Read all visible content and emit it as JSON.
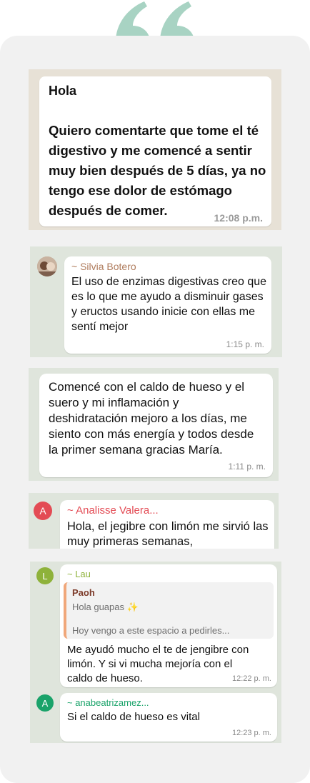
{
  "colors": {
    "quote": "#a8d3c3",
    "card_bg": "#f1f1f1",
    "sender_silvia": "#b07d5e",
    "sender_analisse": "#e34b54",
    "sender_lau": "#8eb23a",
    "sender_anabea": "#1aa36a",
    "reply_accent": "#f0a77a",
    "reply_name": "#7d3b2a"
  },
  "icons": {
    "quote": "double-quote-icon",
    "sparkle": "sparkles-emoji-icon"
  },
  "messages": {
    "m1": {
      "greeting": "Hola",
      "body": "Quiero comentarte que tome el té digestivo y me comencé a sentir muy bien después de 5 días, ya no tengo ese dolor de estómago después de comer.",
      "time": "12:08 p.m."
    },
    "m2": {
      "sender": "~ Silvia Botero",
      "body": "El uso de enzimas digestivas creo que es lo que me ayudo a disminuir gases y eructos  usando inicie con ellas me sentí mejor",
      "time": "1:15 p. m."
    },
    "m3": {
      "body": "Comencé con el caldo de hueso y el suero y mi inflamación y deshidratación mejoro a los días, me siento con más energía y todos desde la primer semana gracias María.",
      "time": "1:11 p. m."
    },
    "m4": {
      "avatar": "A",
      "sender": "~ Analisse Valera...",
      "body": "Hola, el jegibre con limón me sirvió las muy primeras semanas,"
    },
    "m5": {
      "avatar": "L",
      "sender": "~ Lau",
      "reply_name": "Paoh",
      "reply_line1": "Hola guapas ✨",
      "reply_line2": "Hoy vengo a este espacio a pedirles...",
      "body": "Me ayudó mucho el te de jengibre con limón. Y si vi mucha mejoría con el caldo de hueso.",
      "time": "12:22 p. m."
    },
    "m6": {
      "avatar": "A",
      "sender": "~ anabeatrizamez...",
      "body": "Si el caldo de hueso es vital",
      "time": "12:23 p. m."
    }
  }
}
